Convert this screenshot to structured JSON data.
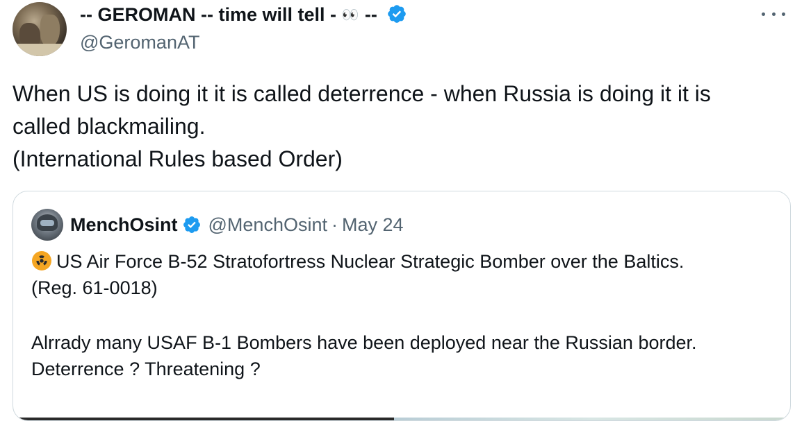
{
  "author": {
    "name_prefix": "-- GEROMAN -- time will tell - ",
    "name_emoji": "👀",
    "name_suffix": " --",
    "handle": "@GeromanAT",
    "verified_icon": "verified-badge-icon"
  },
  "menu": {
    "icon": "more-options-icon"
  },
  "tweet": {
    "lines": [
      "When US is doing it it is called deterrence - when Russia is doing it it is",
      "called blackmailing.",
      "(International Rules based Order)"
    ]
  },
  "quote": {
    "name": "MenchOsint",
    "handle": "@MenchOsint",
    "separator": "·",
    "date": "May 24",
    "icon": "radioactive-icon",
    "line1": "US Air Force B-52 Stratofortress Nuclear Strategic Bomber over the Baltics.",
    "line2": "(Reg. 61-0018)",
    "line3": "Alrrady many USAF B-1 Bombers have been deployed near the Russian border.",
    "line4": "Deterrence ? Threatening ?"
  },
  "colors": {
    "text": "#0f1419",
    "secondary": "#536471",
    "verified": "#1d9bf0",
    "border": "#cfd9de",
    "radioactive": "#f5a623"
  }
}
